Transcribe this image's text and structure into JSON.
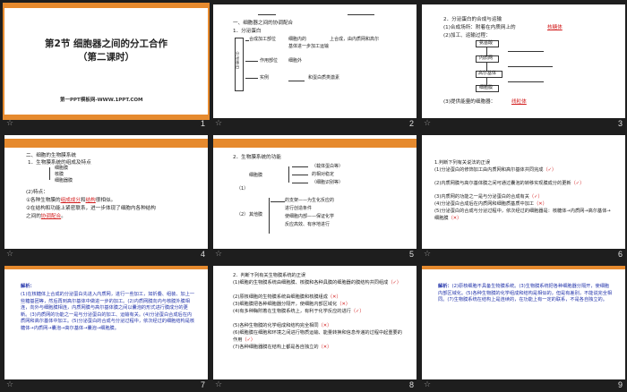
{
  "slides": [
    {
      "number": "1",
      "title": "第2节  细胞器之间的分工合作",
      "subtitle": "（第二课时）",
      "footer": "第一PPT模板网-WWW.1PPT.COM"
    },
    {
      "number": "2",
      "header": "一、细胞器之间的协调配合",
      "item1": "1．分泌蛋白",
      "side": "分泌蛋白",
      "row1a": "合成加工部位",
      "row1b": "细胞内的",
      "row1c": "上合成，由内质网和高尔",
      "row1d": "基体进一步加工运输",
      "row2a": "作用部位",
      "row2b": "细胞外",
      "row3a": "实例",
      "row3b": "和蛋白质类激素"
    },
    {
      "number": "3",
      "item2": "2．分泌蛋白的合成与运输",
      "s1": "(1)合成场所：附着在内质网上的",
      "s1ans": "核糖体",
      "s2": "(2)加工、运输过程：",
      "n1": "氨基酸",
      "n2": "内质网",
      "n3": "高尔基体",
      "n4": "细胞膜",
      "s3": "(3)提供能量的细胞器：",
      "s3ans": "线粒体"
    },
    {
      "number": "4",
      "h1": "二、细胞的生物膜系统",
      "h2": "1．生物膜系统的组成及特点",
      "l1": "细胞膜",
      "l2": "核膜",
      "l3": "细胞器膜",
      "p2": "(2)特点：",
      "p2a": "①各种生物膜的",
      "p2b": "组成成分",
      "p2c": "和",
      "p2d": "结构",
      "p2e": "很相似。",
      "p3": "②在结构和功能上紧密联系，进一步体现了细胞内各种结构",
      "p3b": "之间的",
      "p3c": "协调配合",
      "p3d": "。"
    },
    {
      "number": "5",
      "h": "2．生物膜系统的功能",
      "a": "（载体蛋白等）",
      "b": "的相对稳定",
      "c": "（细胞识别等）",
      "d": "细胞膜",
      "e": "（1）",
      "f": "（2）",
      "g": "其他膜",
      "h1": "的支架——为生化反应的",
      "h2": "进行创造条件",
      "h3": "使细胞内部——保证化学",
      "h4": "反应高效、有序地进行"
    },
    {
      "number": "6",
      "h": "1.判断下列有关说法的正误",
      "q1": "(1)分泌蛋白的修饰加工由内质网和高尔基体共同完成",
      "q1m": "（✓）",
      "q2": "(2)内质网膜与高尔基体膜之间可通过囊泡的转移实现膜成分的更新",
      "q2m": "（✓）",
      "q3": "(3)内质网的功能之一是与分泌蛋白的合成有关",
      "q3m": "（✓）",
      "q4": "(4)分泌蛋白合成后在内质网和细胞质基质中加工",
      "q4m": "（✕）",
      "q5": "(5)分泌蛋白的合成与分泌过程中，依次经过的细胞器是：核糖体→内质网→高尔基体→细胞膜",
      "q5m": "（✕）"
    },
    {
      "number": "7",
      "h": "解析：",
      "t": "(1)在核糖体上合成的分泌蛋白先进入内质网，进行一些加工，如折叠、组装、加上一些糖基团等，然后再到高尔基体中做进一步的加工。(2)内质网膜向内与核膜外膜相连，向外与细胞膜相连，内质网膜与高尔基体膜之间以囊泡的形式进行膜成分的更新。(3)内质网的功能之一是与分泌蛋白的加工、运输有关。(4)分泌蛋白合成后在内质网和高尔基体中加工。(5)分泌蛋白的合成与分泌过程中，依次经过的细胞结构是核糖体→内质网→囊泡→高尔基体→囊泡→细胞膜。"
    },
    {
      "number": "8",
      "h": "2．判断下列有关生物膜系统的正误",
      "q1": "(1)细胞的生物膜系统由细胞膜、核膜和各种具膜的细胞器的膜结构共同组成",
      "q1m": "（✓）",
      "q2": "(2)原核细胞的生物膜系统由细胞膜和核膜组成",
      "q2m": "（✕）",
      "q3": "(3)细胞膜把各种细胞器分隔开，使细胞内部区域化",
      "q3m": "（✕）",
      "q4": "(4)有多种酶附着在生物膜系统上，有利于化学反应的进行",
      "q4m": "（✓）",
      "q5": "(5)各种生物膜的化学组成和结构完全相同",
      "q5m": "（✕）",
      "q6": "(6)细胞膜在细胞和环境之间进行物质运输、能量转换和信息传递的过程中起重要的作用",
      "q6m": "（✓）",
      "q7": "(7)各种细胞器膜在结构上都是各自独立的",
      "q7m": "（✕）"
    },
    {
      "number": "9",
      "h": "解析：",
      "t": "(2)原核细胞不具备生物膜系统。(3)生物膜系统把各种细胞器分隔开，使细胞内部区域化。(5)各种生物膜的化学组成和结构是相似的，但是有差别，不能说完全相同。(7)生物膜系统在结构上是连续的，在功能上有一定的联系，不是各自独立的。"
    }
  ],
  "colors": {
    "accent": "#e68a2e",
    "answer_red": "#d21e1e",
    "selected_outline": "#e68a2e",
    "background": "#1e1e1e"
  }
}
